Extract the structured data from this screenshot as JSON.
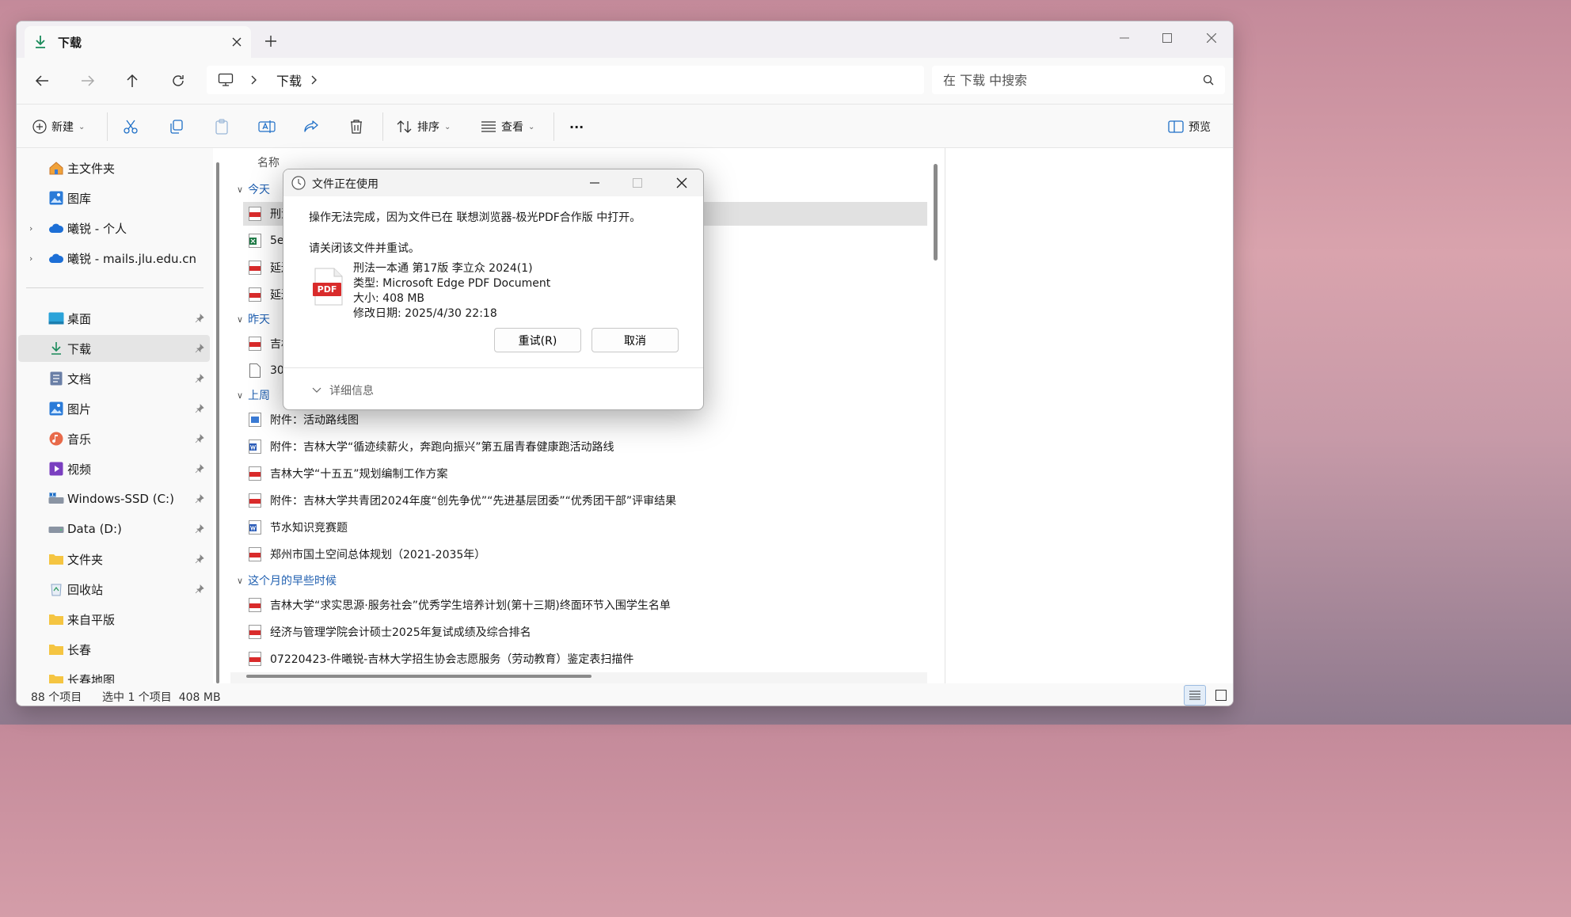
{
  "window": {
    "tab_title": "下载",
    "new_tab": "+"
  },
  "nav": {
    "breadcrumb": "下载",
    "search_placeholder": "在 下载 中搜索"
  },
  "toolbar": {
    "new_label": "新建",
    "sort_label": "排序",
    "view_label": "查看",
    "more_label": "···",
    "preview_label": "预览"
  },
  "sidebar": {
    "items": [
      {
        "label": "主文件夹"
      },
      {
        "label": "图库"
      },
      {
        "label": "曦锐 - 个人"
      },
      {
        "label": "曦锐 - mails.jlu.edu.cn"
      },
      {
        "label": "桌面"
      },
      {
        "label": "下载"
      },
      {
        "label": "文档"
      },
      {
        "label": "图片"
      },
      {
        "label": "音乐"
      },
      {
        "label": "视频"
      },
      {
        "label": "Windows-SSD (C:)"
      },
      {
        "label": "Data (D:)"
      },
      {
        "label": "文件夹"
      },
      {
        "label": "回收站"
      },
      {
        "label": "来自平版"
      },
      {
        "label": "长春"
      },
      {
        "label": "长春地图"
      }
    ]
  },
  "file_list": {
    "column_name": "名称",
    "groups": {
      "today": "今天",
      "yesterday": "昨天",
      "last_week": "上周",
      "earlier_month": "这个月的早些时候"
    },
    "today_files": [
      "刑法",
      "5ea",
      "延边",
      "延边"
    ],
    "yesterday_files": [
      "吉林",
      "305"
    ],
    "last_week_files": [
      "附件：活动路线图",
      "附件：吉林大学“循迹续薪火，奔跑向振兴”第五届青春健康跑活动路线",
      "吉林大学“十五五”规划编制工作方案",
      "附件：吉林大学共青团2024年度“创先争优”“先进基层团委”“优秀团干部”评审结果",
      "节水知识竞赛题",
      "郑州市国土空间总体规划（2021-2035年）"
    ],
    "earlier_files": [
      "吉林大学“求实思源·服务社会”优秀学生培养计划(第十三期)终面环节入围学生名单",
      "经济与管理学院会计硕士2025年复试成绩及综合排名",
      "07220423-件曦锐-吉林大学招生协会志愿服务（劳动教育）鉴定表扫描件"
    ]
  },
  "status": {
    "count": "88 个项目",
    "selection": "选中 1 个项目  408 MB"
  },
  "dialog": {
    "title": "文件正在使用",
    "message": "操作无法完成，因为文件已在 联想浏览器-极光PDF合作版 中打开。",
    "instruction": "请关闭该文件并重试。",
    "file_name": "刑法一本通 第17版 李立众 2024(1)",
    "file_type": "类型: Microsoft Edge PDF Document",
    "file_size": "大小: 408 MB",
    "file_date": "修改日期: 2025/4/30 22:18",
    "pdf_badge": "PDF",
    "retry_label": "重试(R)",
    "cancel_label": "取消",
    "details_label": "详细信息"
  }
}
